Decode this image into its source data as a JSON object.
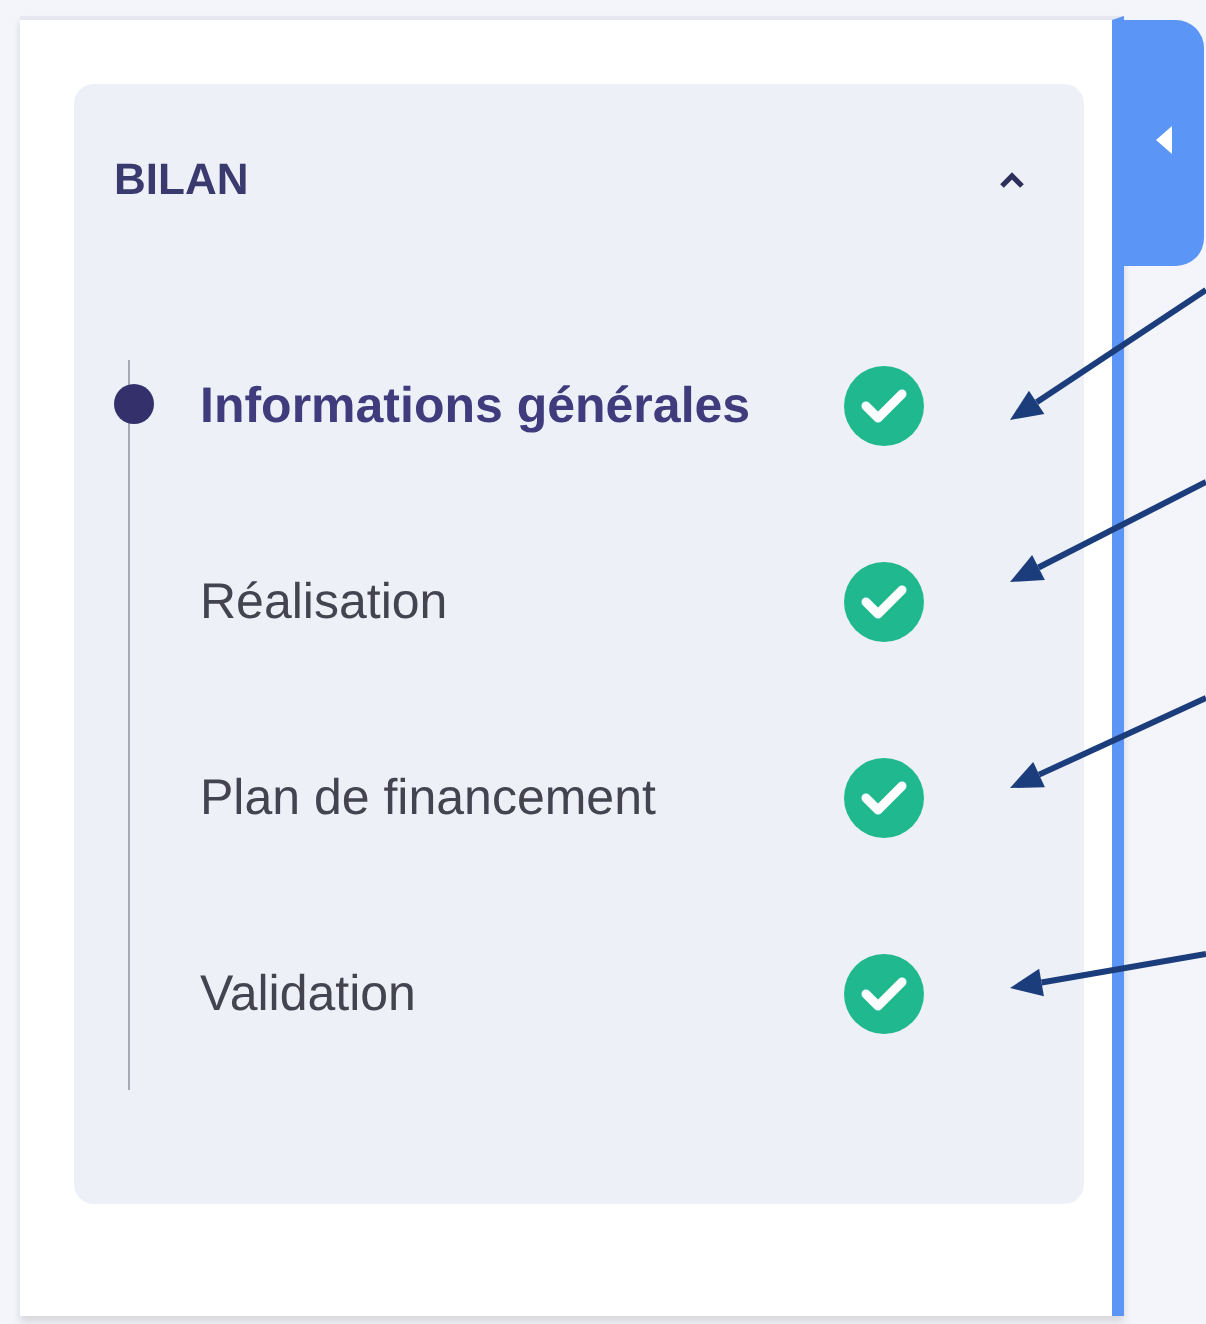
{
  "section": {
    "title": "BILAN",
    "expanded": true
  },
  "steps": [
    {
      "label": "Informations générales",
      "selected": true,
      "done": true,
      "pointed": true
    },
    {
      "label": "Réalisation",
      "selected": false,
      "done": true,
      "pointed": true
    },
    {
      "label": "Plan de financement",
      "selected": false,
      "done": true,
      "pointed": true
    },
    {
      "label": "Validation",
      "selected": false,
      "done": true,
      "pointed": true
    }
  ]
}
